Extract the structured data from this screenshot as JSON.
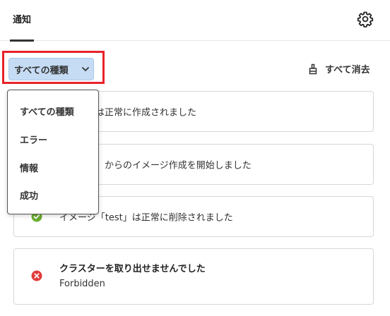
{
  "header": {
    "tab_label": "通知",
    "settings_icon": "gear-icon"
  },
  "filter": {
    "label": "すべての種類",
    "icon": "chevron-down-icon",
    "highlight_color": "#e8222a",
    "button_color": "#c6dcf4"
  },
  "clear_all": {
    "label": "すべて消去",
    "icon": "broom-icon"
  },
  "dropdown": {
    "options": [
      "すべての種類",
      "エラー",
      "情報",
      "成功"
    ]
  },
  "notifications": [
    {
      "status": "success",
      "message": "「test」は正常に作成されました"
    },
    {
      "status": "success",
      "message": "ム「test」からのイメージ作成を開始しました"
    },
    {
      "status": "success",
      "message": "イメージ「test」は正常に削除されました"
    },
    {
      "status": "error",
      "title": "クラスターを取り出せませんでした",
      "detail": "Forbidden"
    }
  ],
  "colors": {
    "success": "#6aac2f",
    "error": "#e23b3b"
  }
}
